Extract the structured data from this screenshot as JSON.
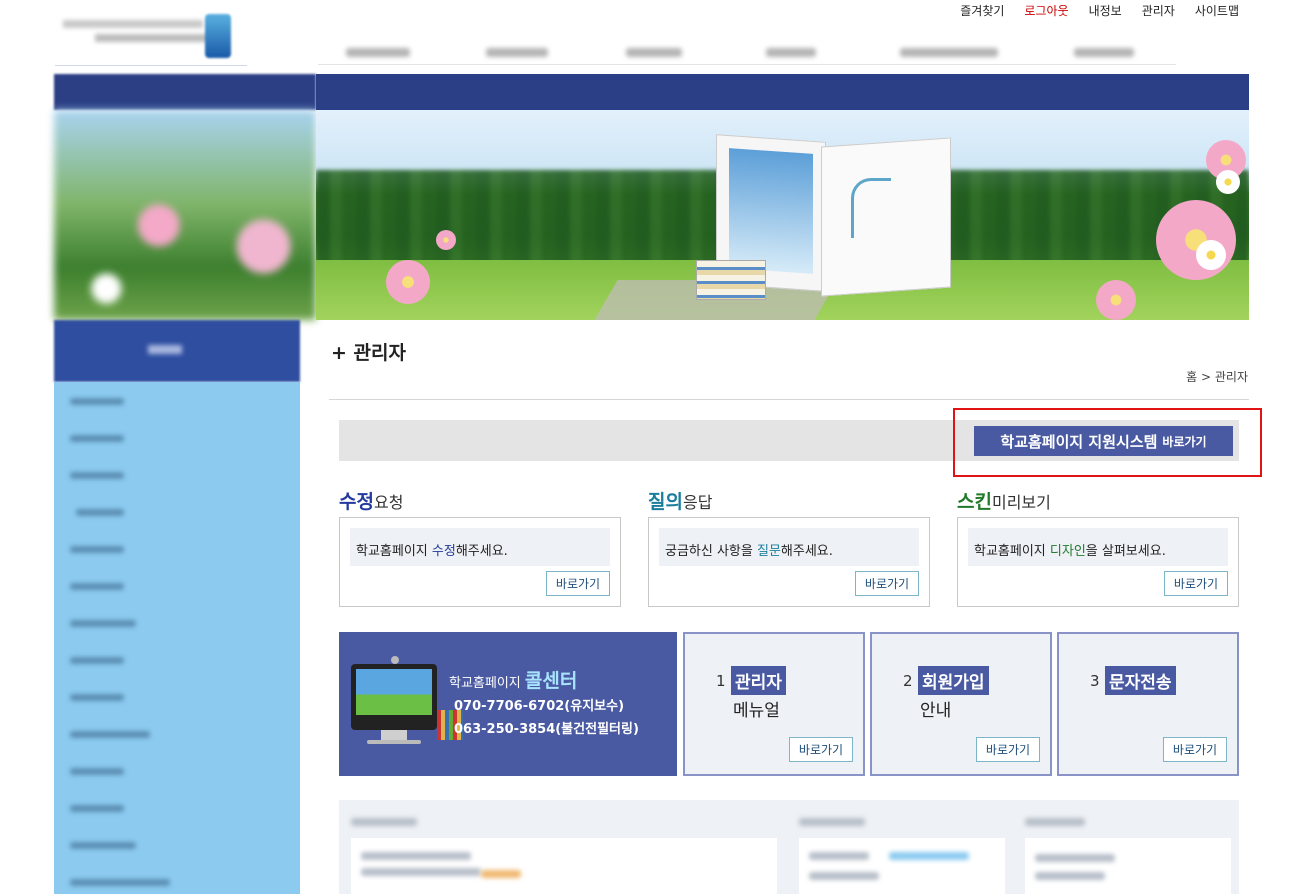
{
  "util_links": [
    "즐겨찾기",
    "로그아웃",
    "내정보",
    "관리자",
    "사이트맵"
  ],
  "page_title": "+ 관리자",
  "breadcrumb": "홈 > 관리자",
  "support": {
    "main": "학교홈페이지 지원시스템",
    "sub": "바로가기"
  },
  "sections": [
    {
      "title_strong": "수정",
      "title_rest": "요청",
      "text_pre": "학교홈페이지 ",
      "text_hl": "수정",
      "text_post": "해주세요.",
      "button": "바로가기"
    },
    {
      "title_strong": "질의",
      "title_rest": "응답",
      "text_pre": "궁금하신 사항을 ",
      "text_hl": "질문",
      "text_post": "해주세요.",
      "button": "바로가기"
    },
    {
      "title_strong": "스킨",
      "title_rest": "미리보기",
      "text_pre": "학교홈페이지 ",
      "text_hl": "디자인",
      "text_post": "을 살펴보세요.",
      "button": "바로가기"
    }
  ],
  "call_center": {
    "prefix": "학교홈페이지 ",
    "title": "콜센터",
    "phone1": "070-7706-6702(유지보수)",
    "phone2": "063-250-3854(불건전필터링)"
  },
  "menu_boxes": [
    {
      "num": "1",
      "label": "관리자",
      "sub": "메뉴얼",
      "button": "바로가기"
    },
    {
      "num": "2",
      "label": "회원가입",
      "sub": "안내",
      "button": "바로가기"
    },
    {
      "num": "3",
      "label": "문자전송",
      "sub": "",
      "button": "바로가기"
    }
  ],
  "colors": {
    "nav_dark": "#2b3f86",
    "button_purple": "#4a5aa2",
    "highlight_red": "#e01414",
    "sidebar_blue": "#8ccaf0"
  }
}
